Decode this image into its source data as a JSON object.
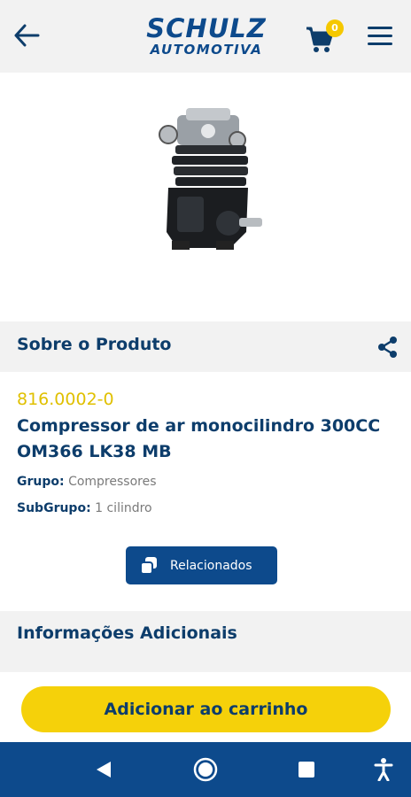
{
  "header": {
    "logo_main": "SCHULZ",
    "logo_sub": "AUTOMOTIVA",
    "cart_count": "0",
    "icons": [
      "back-arrow-icon",
      "cart-icon",
      "menu-icon"
    ]
  },
  "product": {
    "image_alt": "Compressor de ar monocilindro",
    "section_title": "Sobre o Produto",
    "code": "816.0002-0",
    "name": "Compressor de ar monocilindro 300CC OM366 LK38 MB",
    "group_label": "Grupo:",
    "group_value": "Compressores",
    "subgroup_label": "SubGrupo:",
    "subgroup_value": "1 cilindro",
    "related_label": "Relacionados"
  },
  "additional": {
    "title": "Informações Adicionais"
  },
  "actions": {
    "add_to_cart": "Adicionar ao carrinho"
  },
  "colors": {
    "brand_blue": "#0d4a8c",
    "accent_yellow": "#f5d10a",
    "code_yellow": "#e0c000"
  },
  "system_nav": {
    "icons": [
      "nav-back-icon",
      "nav-home-icon",
      "nav-recents-icon",
      "accessibility-icon"
    ]
  }
}
